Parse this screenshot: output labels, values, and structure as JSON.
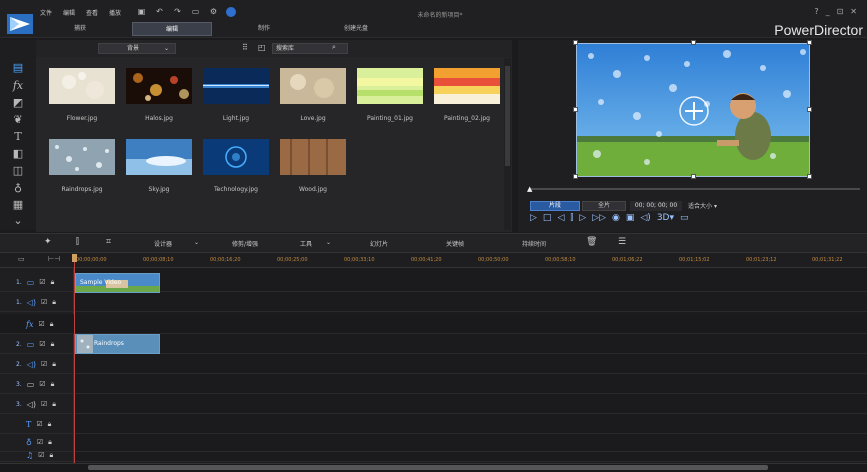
{
  "menu": [
    "文件",
    "编辑",
    "查看",
    "播放"
  ],
  "project_title": "未命名的新项目*",
  "brand": "PowerDirector",
  "window_controls": [
    "?",
    "_",
    "⊡",
    "✕"
  ],
  "mode_tabs": [
    {
      "label": "捕获",
      "active": false
    },
    {
      "label": "编辑",
      "active": true
    },
    {
      "label": "制作",
      "active": false
    },
    {
      "label": "创建光盘",
      "active": false
    }
  ],
  "library": {
    "filter": "背景",
    "search_placeholder": "搜索库",
    "items": [
      {
        "label": "Flower.jpg"
      },
      {
        "label": "Halos.jpg"
      },
      {
        "label": "Light.jpg"
      },
      {
        "label": "Love.jpg"
      },
      {
        "label": "Painting_01.jpg"
      },
      {
        "label": "Painting_02.jpg"
      },
      {
        "label": "Raindrops.jpg"
      },
      {
        "label": "Sky.jpg"
      },
      {
        "label": "Technology.jpg"
      },
      {
        "label": "Wood.jpg"
      }
    ]
  },
  "preview": {
    "clip_label": "片段",
    "movie_label": "全片",
    "timecode": "00; 00; 00; 00",
    "fit": "适合大小"
  },
  "timeline_toolbar": {
    "designer": "设计器",
    "trim": "修剪/增强",
    "tools": "工具",
    "slideshow": "幻灯片",
    "keyframe": "关键帧",
    "duration": "持续时间"
  },
  "ruler_ticks": [
    "00;00;00;00",
    "00;00;08;10",
    "00;00;16;20",
    "00;00;25;00",
    "00;00;33;10",
    "00;00;41;20",
    "00;00;50;00",
    "00;00;58;10",
    "00;01;06;22",
    "00;01;15;02",
    "00;01;23;12",
    "00;01;31;22"
  ],
  "tracks": [
    {
      "num": "1.",
      "icon": "video-track-icon"
    },
    {
      "num": "1.",
      "icon": "audio-track-icon"
    },
    {
      "num": "",
      "icon": "fx-track-icon"
    },
    {
      "num": "2.",
      "icon": "video-track-icon"
    },
    {
      "num": "2.",
      "icon": "audio-track-icon"
    },
    {
      "num": "3.",
      "icon": "video-track-icon"
    },
    {
      "num": "3.",
      "icon": "audio-track-icon"
    },
    {
      "num": "",
      "icon": "title-track-icon"
    },
    {
      "num": "",
      "icon": "voice-track-icon"
    },
    {
      "num": "",
      "icon": "music-track-icon"
    }
  ],
  "clips": [
    {
      "label": "Sample Video"
    },
    {
      "label": "Raindrops"
    }
  ]
}
